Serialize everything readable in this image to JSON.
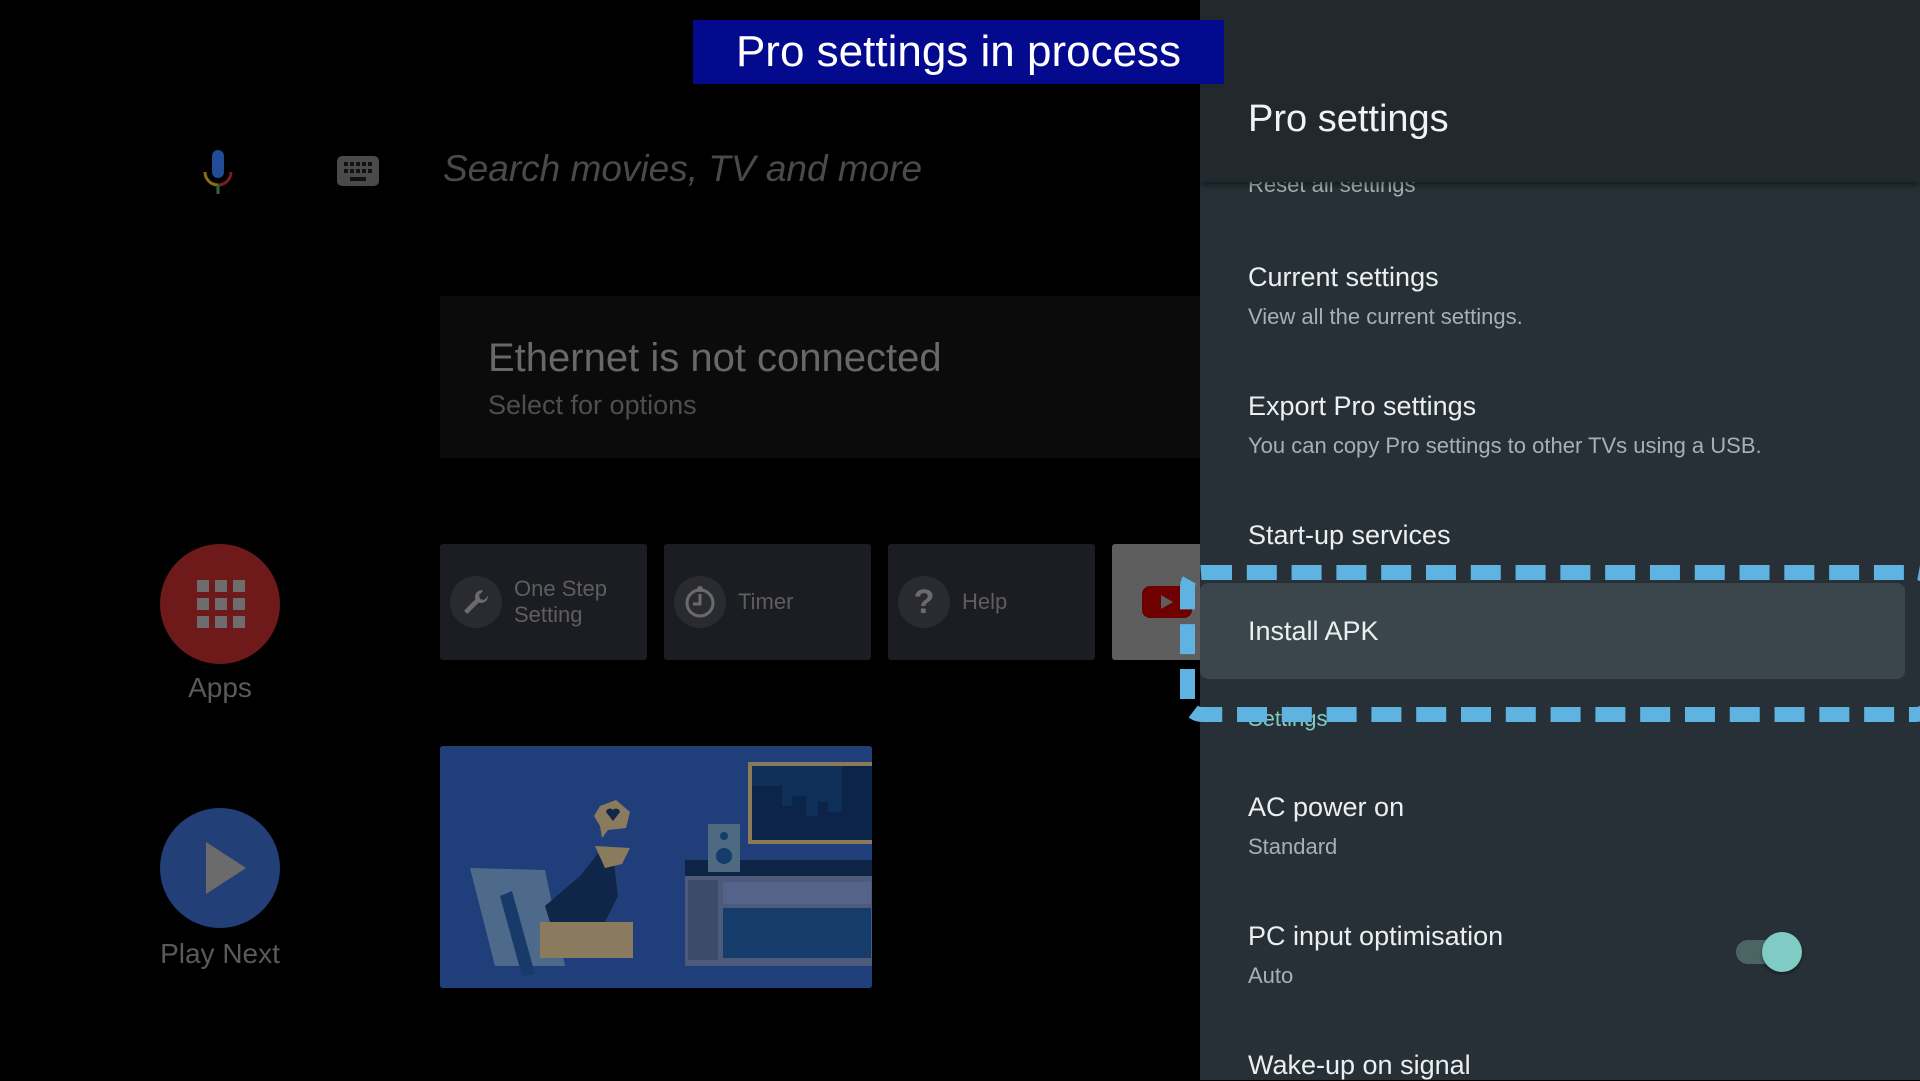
{
  "banner": {
    "text": "Pro settings in process",
    "color": "#040a8e"
  },
  "home": {
    "search": {
      "placeholder": "Search movies, TV and more",
      "mic_icon": "microphone-icon",
      "keyboard_icon": "keyboard-icon"
    },
    "network_card": {
      "title": "Ethernet is not connected",
      "subtitle": "Select for options"
    },
    "apps": {
      "label": "Apps",
      "icon": "apps-grid-icon",
      "color": "#6e1a1a"
    },
    "play_next": {
      "label": "Play Next",
      "icon": "play-icon",
      "color": "#223f78"
    },
    "tiles": [
      {
        "label": "One Step Setting",
        "icon": "wrench-icon"
      },
      {
        "label": "Timer",
        "icon": "timer-icon"
      },
      {
        "label": "Help",
        "icon": "help-icon"
      },
      {
        "label": "",
        "icon": "youtube-icon"
      }
    ]
  },
  "panel": {
    "title": "Pro settings",
    "items": [
      {
        "title": "Reset all settings",
        "subtitle": ""
      },
      {
        "title": "Current settings",
        "subtitle": "View all the current settings."
      },
      {
        "title": "Export Pro settings",
        "subtitle": "You can copy Pro settings to other TVs using a USB."
      },
      {
        "title": "Start-up services",
        "subtitle": ""
      },
      {
        "title": "Install APK",
        "subtitle": "",
        "focused": true
      }
    ],
    "section_label": "Settings",
    "settings": [
      {
        "title": "AC power on",
        "value": "Standard"
      },
      {
        "title": "PC input optimisation",
        "value": "Auto",
        "toggle": "on"
      },
      {
        "title": "Wake-up on signal",
        "value": ""
      }
    ],
    "accent": "#80cbc4",
    "focus_color": "#5fb3e0"
  }
}
